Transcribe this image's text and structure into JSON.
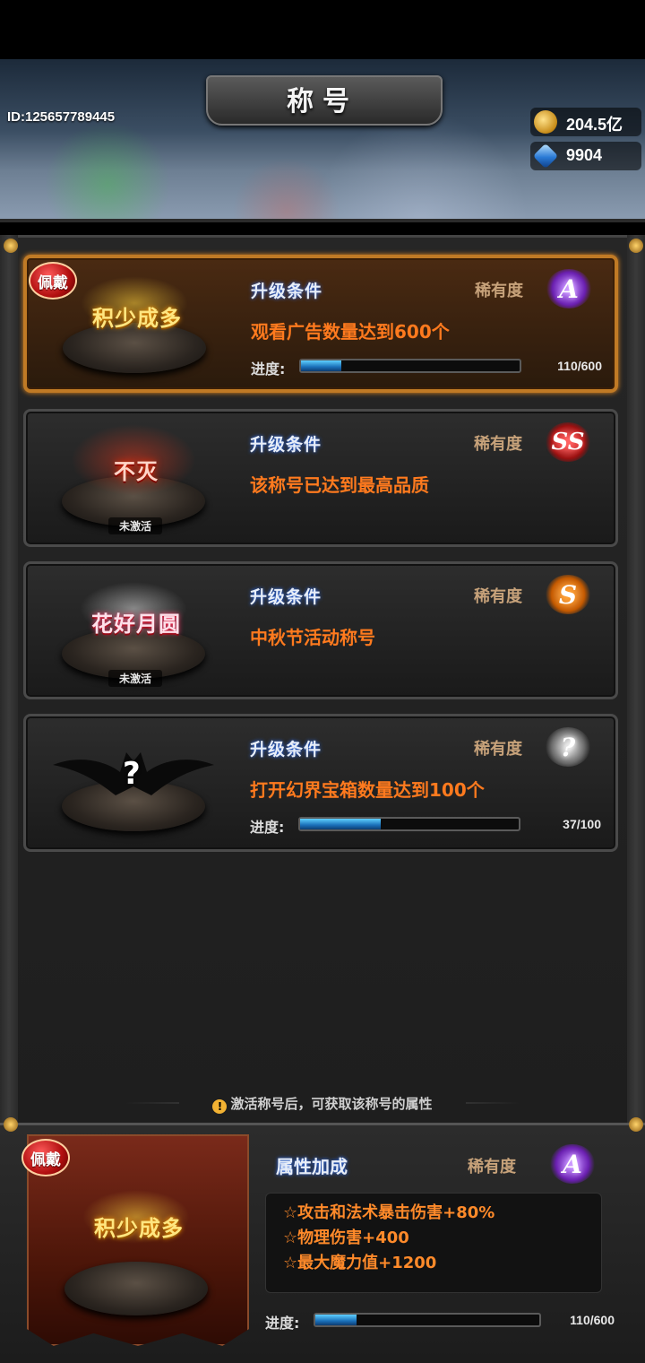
{
  "header": {
    "title": "称号",
    "player_id": "ID:125657789445",
    "gold": "204.5亿",
    "gems": "9904"
  },
  "titles": [
    {
      "name": "积少成多",
      "equipped": true,
      "equipped_label": "佩戴",
      "condition_label": "升级条件",
      "rarity_label": "稀有度",
      "rarity": "A",
      "condition": "观看广告数量达到600个",
      "progress_label": "进度:",
      "progress_text": "110/600",
      "progress_fraction": 0.183
    },
    {
      "name": "不灭",
      "status": "未激活",
      "condition_label": "升级条件",
      "rarity_label": "稀有度",
      "rarity": "SS",
      "condition": "该称号已达到最高品质"
    },
    {
      "name": "花好月圆",
      "status": "未激活",
      "condition_label": "升级条件",
      "rarity_label": "稀有度",
      "rarity": "S",
      "condition": "中秋节活动称号"
    },
    {
      "name": "?",
      "condition_label": "升级条件",
      "rarity_label": "稀有度",
      "rarity": "?",
      "condition": "打开幻界宝箱数量达到100个",
      "progress_label": "进度:",
      "progress_text": "37/100",
      "progress_fraction": 0.37
    }
  ],
  "hint": "激活称号后，可获取该称号的属性",
  "bottom": {
    "equipped_label": "佩戴",
    "emblem_name": "积少成多",
    "attr_title": "属性加成",
    "rarity_label": "稀有度",
    "rarity": "A",
    "attributes": [
      "☆攻击和法术暴击伤害+80%",
      "☆物理伤害+400",
      "☆最大魔力值+1200"
    ],
    "progress_label": "进度:",
    "progress_text": "110/600",
    "progress_fraction": 0.183
  }
}
